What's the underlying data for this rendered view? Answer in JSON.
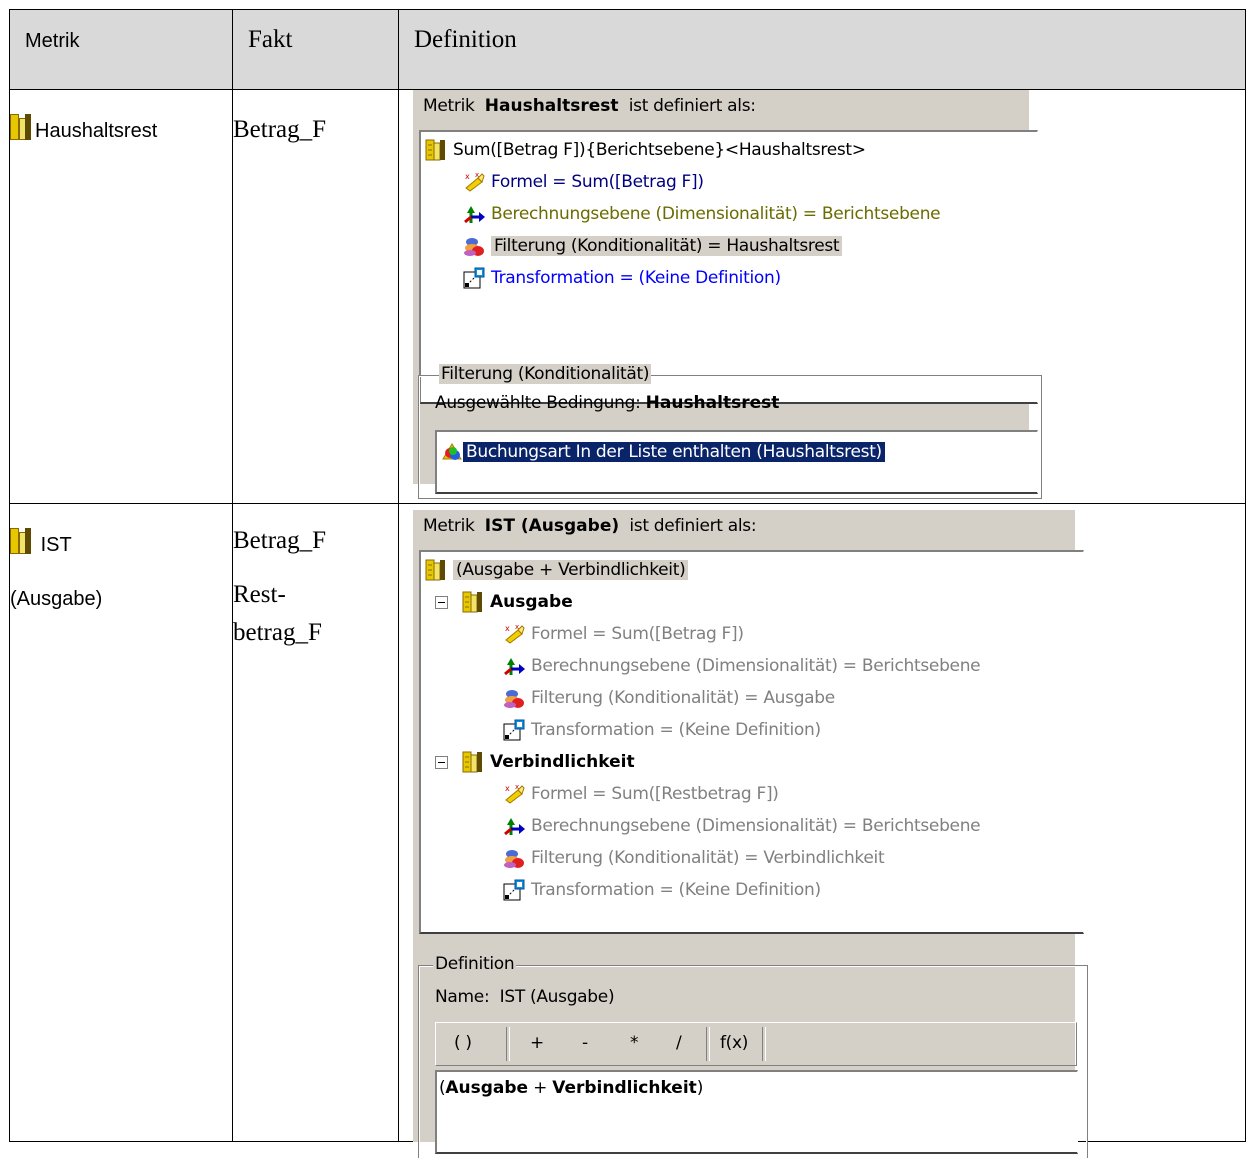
{
  "table": {
    "headers": {
      "metric": "Metrik",
      "fact": "Fakt",
      "definition": "Definition"
    },
    "rows": [
      {
        "metric": "Haushaltsrest",
        "facts": [
          "Betrag_F"
        ],
        "dialog": {
          "title_prefix": "Metrik",
          "title_name": "Haushaltsrest",
          "title_suffix": "ist definiert als:",
          "tree_root": "Sum([Betrag F]){Berichtsebene}<Haushaltsrest>",
          "formula": "Formel = Sum([Betrag F])",
          "level": "Berechnungsebene (Dimensionalität) = Berichtsebene",
          "filter": "Filterung (Konditionalität) = Haushaltsrest",
          "transformation": "Transformation = (Keine Definition)",
          "group_label": "Filterung (Konditionalität)",
          "selected_condition_label": "Ausgewählte Bedingung:",
          "selected_condition_value": "Haushaltsrest",
          "condition_item": "Buchungsart In der Liste enthalten (Haushaltsrest)"
        }
      },
      {
        "metric_line1": "IST",
        "metric_line2": "(Ausgabe)",
        "facts": [
          "Betrag_F",
          "Rest-",
          "betrag_F"
        ],
        "dialog": {
          "title_prefix": "Metrik",
          "title_name": "IST (Ausgabe)",
          "title_suffix": "ist definiert als:",
          "tree_root": "(Ausgabe + Verbindlichkeit)",
          "nodes": [
            {
              "name": "Ausgabe",
              "formula": "Formel = Sum([Betrag F])",
              "level": "Berechnungsebene (Dimensionalität) = Berichtsebene",
              "filter": "Filterung (Konditionalität) = Ausgabe",
              "transformation": "Transformation = (Keine Definition)"
            },
            {
              "name": "Verbindlichkeit",
              "formula": "Formel = Sum([Restbetrag F])",
              "level": "Berechnungsebene (Dimensionalität) = Berichtsebene",
              "filter": "Filterung (Konditionalität) = Verbindlichkeit",
              "transformation": "Transformation = (Keine Definition)"
            }
          ],
          "group_label": "Definition",
          "name_label": "Name:",
          "name_value": "IST (Ausgabe)",
          "toolbar": [
            "( )",
            "+",
            "-",
            "*",
            "/",
            "f(x)"
          ],
          "expression_open": "(",
          "expression_a": "Ausgabe",
          "expression_op": " + ",
          "expression_b": "Verbindlichkeit",
          "expression_close": ")"
        }
      }
    ]
  },
  "colors": {
    "header_bg": "#d9d9d9",
    "dialog_bg": "#d4d0c8",
    "selection": "#0a246a",
    "formula_text": "#000080",
    "level_text": "#6b6b00",
    "transform_text": "#0000ff",
    "disabled_text": "#808080"
  },
  "icons": [
    "metric-icon",
    "formula-icon",
    "dimensionality-icon",
    "filter-icon",
    "transformation-icon",
    "condition-icon",
    "collapse-icon"
  ]
}
